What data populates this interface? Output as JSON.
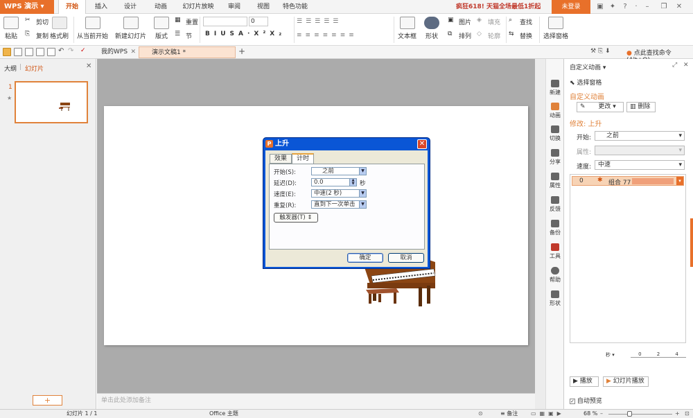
{
  "app": {
    "title": "WPS 演示"
  },
  "menu": {
    "tabs": [
      "开始",
      "插入",
      "设计",
      "动画",
      "幻灯片放映",
      "审阅",
      "视图",
      "特色功能"
    ],
    "active": "开始"
  },
  "promo": "疯狂618! 天猫全场最低1折起",
  "login": "未登录",
  "ribbon": {
    "paste": "粘贴",
    "cut": "剪切",
    "copy": "复制",
    "format_painter": "格式刷",
    "from_current": "从当前开始",
    "new_slide": "新建幻灯片",
    "layout": "版式",
    "reset": "重置",
    "section": "节",
    "font_size": "0",
    "textbox": "文本框",
    "shape": "形状",
    "image": "图片",
    "arrange": "排列",
    "fill": "填充",
    "outline": "轮廓",
    "find": "查找",
    "replace": "替换",
    "select_pane": "选择窗格"
  },
  "quickbar": {
    "tabs": [
      "我的WPS",
      "演示文稿1 *"
    ],
    "search_hint": "点此查找命令 (Alt+Q)"
  },
  "leftpanel": {
    "tab_outline": "大纲",
    "tab_slides": "幻灯片",
    "slide_number": "1",
    "add": "+"
  },
  "notes_placeholder": "单击此处添加备注",
  "rightstrip": [
    "新建",
    "动画",
    "切换",
    "分享",
    "属性",
    "反馈",
    "备份",
    "工具",
    "帮助",
    "形状"
  ],
  "taskpane": {
    "title": "自定义动画",
    "select_pane": "选择窗格",
    "section_title": "自定义动画",
    "change_btn": "更改",
    "delete_btn": "删除",
    "modify_label": "修改: 上升",
    "start_label": "开始:",
    "start_value": "之前",
    "property_label": "属性:",
    "speed_label": "速度:",
    "speed_value": "中速",
    "item_index": "0",
    "item_name": "组合 77",
    "timeline_unit": "秒",
    "timeline_ticks": [
      "0",
      "2",
      "4"
    ],
    "play_btn": "播放",
    "slideshow_btn": "幻灯片播放",
    "autopreview": "自动预览"
  },
  "dialog": {
    "title": "上升",
    "tab_effect": "效果",
    "tab_timing": "计时",
    "start_label": "开始(S):",
    "start_value": "之前",
    "delay_label": "延迟(D):",
    "delay_value": "0.0",
    "delay_unit": "秒",
    "speed_label": "速度(E):",
    "speed_value": "中速(2 秒)",
    "repeat_label": "重复(R):",
    "repeat_value": "直到下一次单击",
    "trigger_btn": "触发器(T)",
    "ok": "确定",
    "cancel": "取消"
  },
  "status": {
    "slide": "幻灯片 1 / 1",
    "theme": "Office 主题",
    "notes": "备注",
    "zoom": "68 %"
  }
}
